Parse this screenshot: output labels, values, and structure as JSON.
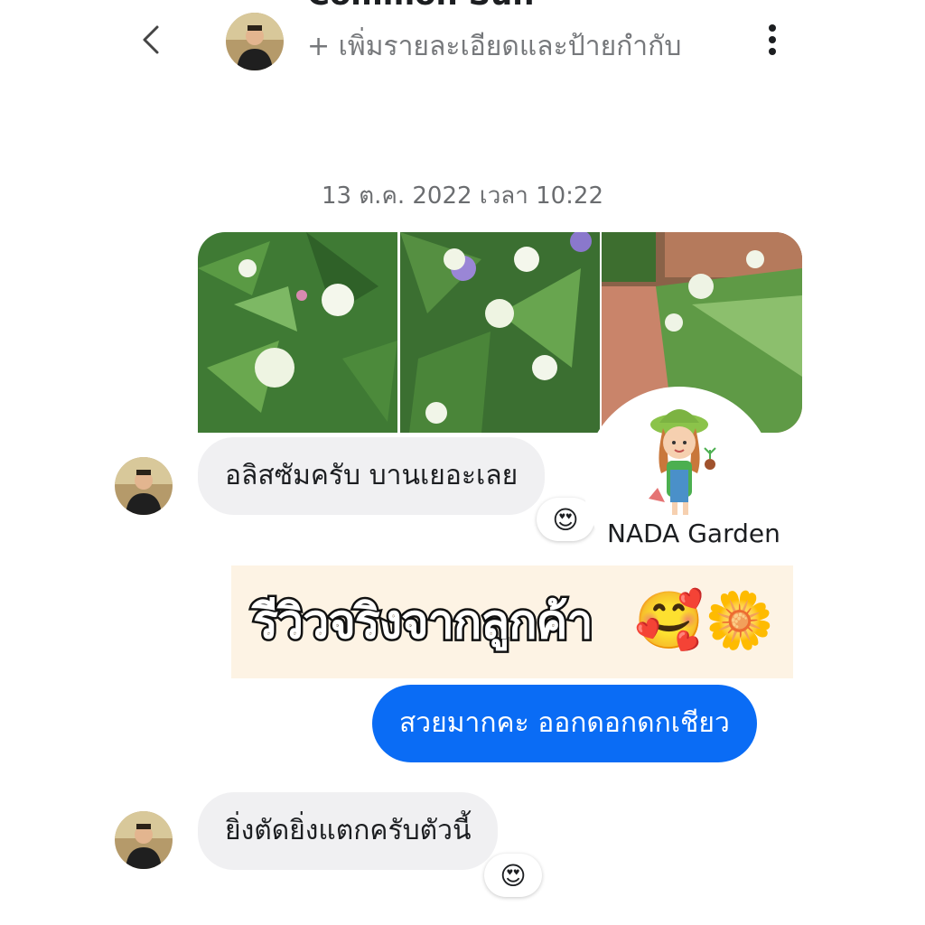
{
  "header": {
    "name": "Common Sun",
    "subtitle": "+ เพิ่มรายละเอียดและป้ายกำกับ"
  },
  "conversation": {
    "timestamp": "13 ต.ค. 2022 เวลา 10:22",
    "photos": [
      "alyssum-flowers-photo-1",
      "alyssum-flowers-photo-2",
      "alyssum-flowers-photo-3"
    ],
    "messages": [
      {
        "from": "contact",
        "text": "อลิสซัมครับ บานเยอะเลย",
        "reaction": "😍"
      },
      {
        "from": "me",
        "text": "สวยมากคะ ออกดอกดกเชียว"
      },
      {
        "from": "contact",
        "text": "ยิ่งตัดยิ่งแตกครับตัวนี้",
        "reaction": "😍"
      }
    ]
  },
  "overlay": {
    "brand": "NADA Garden",
    "banner_text": "รีวิวจริงจากลูกค้า",
    "banner_emojis": [
      "🥰",
      "🌼"
    ]
  },
  "colors": {
    "accent": "#0a6cf5",
    "incoming_bubble": "#f0f0f2",
    "banner_bg": "#fdf3e4"
  },
  "icons": {
    "back": "chevron-left-icon",
    "more": "more-vertical-icon"
  }
}
